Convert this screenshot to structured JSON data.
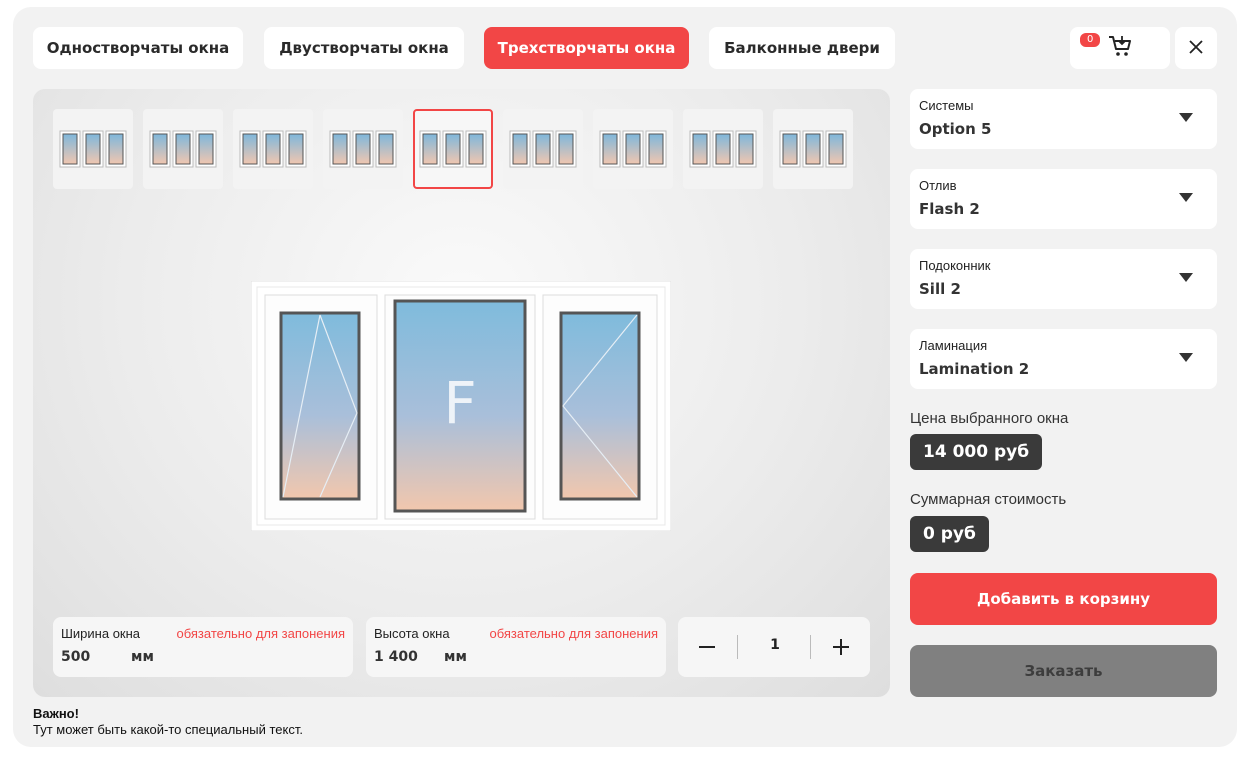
{
  "tabs": [
    {
      "label": "Одностворчаты окна"
    },
    {
      "label": "Двустворчаты окна"
    },
    {
      "label": "Трехстворчаты окна"
    },
    {
      "label": "Балконные двери"
    }
  ],
  "cart": {
    "count": "0"
  },
  "selected_window_glyph": "F",
  "width": {
    "label": "Ширина окна",
    "required": "обязательно для запонения",
    "value": "500",
    "unit": "мм"
  },
  "height": {
    "label": "Высота окна",
    "required": "обязательно для запонения",
    "value": "1 400",
    "unit": "мм"
  },
  "quantity": {
    "value": "1"
  },
  "note": {
    "title": "Важно!",
    "text": "Тут может быть какой-то специальный текст."
  },
  "selects": [
    {
      "label": "Системы",
      "value": "Option 5"
    },
    {
      "label": "Отлив",
      "value": "Flash 2"
    },
    {
      "label": "Подоконник",
      "value": "Sill 2"
    },
    {
      "label": "Ламинация",
      "value": "Lamination 2"
    }
  ],
  "price": {
    "label": "Цена выбранного окна",
    "value": "14 000 руб"
  },
  "total": {
    "label": "Суммарная стоимость",
    "value": "0 руб"
  },
  "buttons": {
    "add": "Добавить в корзину",
    "order": "Заказать"
  },
  "colors": {
    "accent": "#f24646",
    "dark_badge": "#3a3a3a",
    "disabled_button": "#808080"
  }
}
